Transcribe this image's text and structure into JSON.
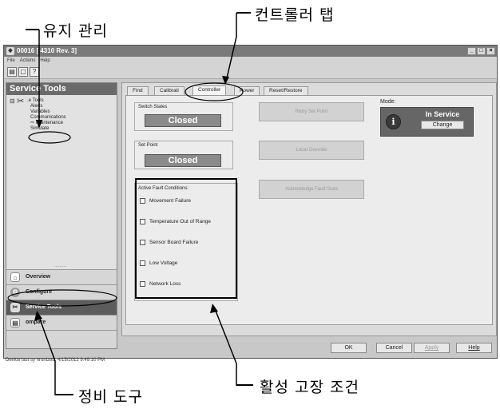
{
  "callouts": {
    "maintenance": "유지 관리",
    "controller_tab": "컨트롤러 탭",
    "active_faults": "활성 고장 조건",
    "service_tools": "정비 도구"
  },
  "window": {
    "title": "00016 [ 4310 Rev. 3]",
    "menu": [
      "File",
      "Actions",
      "Help"
    ],
    "controls": [
      "_",
      "□",
      "×"
    ]
  },
  "left_panel": {
    "header": "Service Tools",
    "tree": [
      "Service Tools",
      "Alerts",
      "Variables",
      "Communications",
      "Maintenance",
      "Simulate"
    ],
    "tree_display": [
      ".e Tools",
      "Alerts",
      "Variables",
      "Communications",
      "Maintenance",
      "Simulate"
    ],
    "nav": [
      {
        "label": "Overview",
        "icon": "overview-icon"
      },
      {
        "label": "Configure",
        "icon": "configure-icon"
      },
      {
        "label": "Service Tools",
        "icon": "service-tools-icon"
      },
      {
        "label": "Compare",
        "icon": "compare-icon"
      }
    ],
    "nav_display": [
      "Overview",
      "Configure",
      "Service Tools",
      "ompare"
    ]
  },
  "tabs": [
    "Find",
    "Calibration",
    "Controller",
    "Power",
    "Reset/Restore"
  ],
  "tabs_display": [
    "Find",
    "Calibrati",
    "Controller",
    "Power",
    "Reset/Restore"
  ],
  "active_tab": "Controller",
  "controller": {
    "switch_states_label": "Switch States",
    "switch_states_value": "Closed",
    "set_point_label": "Set Point",
    "set_point_value": "Closed",
    "retry_set_point": "Retry Set Point",
    "local_override": "Local Override",
    "acknowledge_fault_state": "Acknowledge Fault State",
    "mode_label": "Mode:",
    "mode_value": "In Service",
    "mode_change": "Change"
  },
  "faults": {
    "label": "Active Fault Conditions:",
    "items": [
      "Movement Failure",
      "Temperature Out of Range",
      "Sensor Board Failure",
      "Low Voltage",
      "Network Loss"
    ]
  },
  "footer_buttons": [
    "OK",
    "Cancel",
    "Apply",
    "Help"
  ],
  "status": "Device last synchronized: 4/15/2012 9:49:10 PM",
  "status_display": "Device last sy   nronized: 4/15/2012 9:49:10 PM"
}
